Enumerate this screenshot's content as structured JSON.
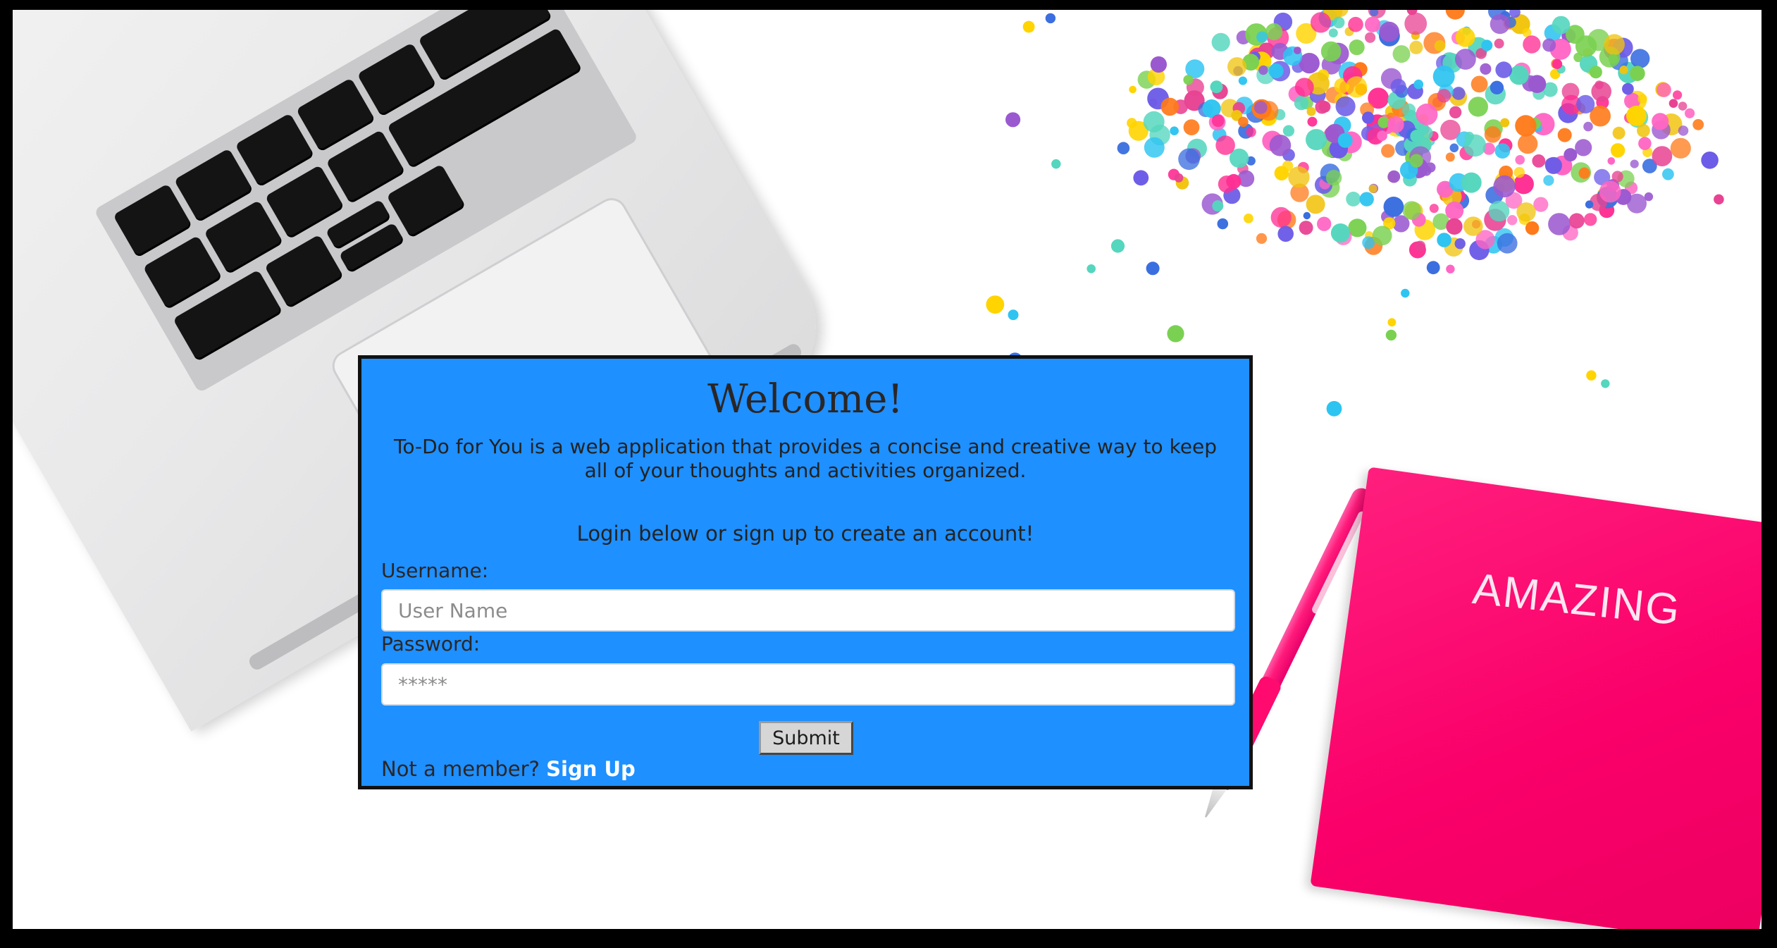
{
  "login": {
    "title": "Welcome!",
    "description": "To-Do for You is a web application that provides a concise and creative way to keep all of your thoughts and activities organized.",
    "prompt": "Login below or sign up to create an account!",
    "username_label": "Username:",
    "username_placeholder": "User Name",
    "username_value": "",
    "password_label": "Password:",
    "password_placeholder": "*****",
    "password_value": "",
    "submit_label": "Submit",
    "member_question": "Not a member?",
    "signup_label": "Sign Up"
  },
  "background": {
    "notebook_text": "AMAZING",
    "card_color": "#1e90ff",
    "notebook_color": "#fa006a"
  }
}
